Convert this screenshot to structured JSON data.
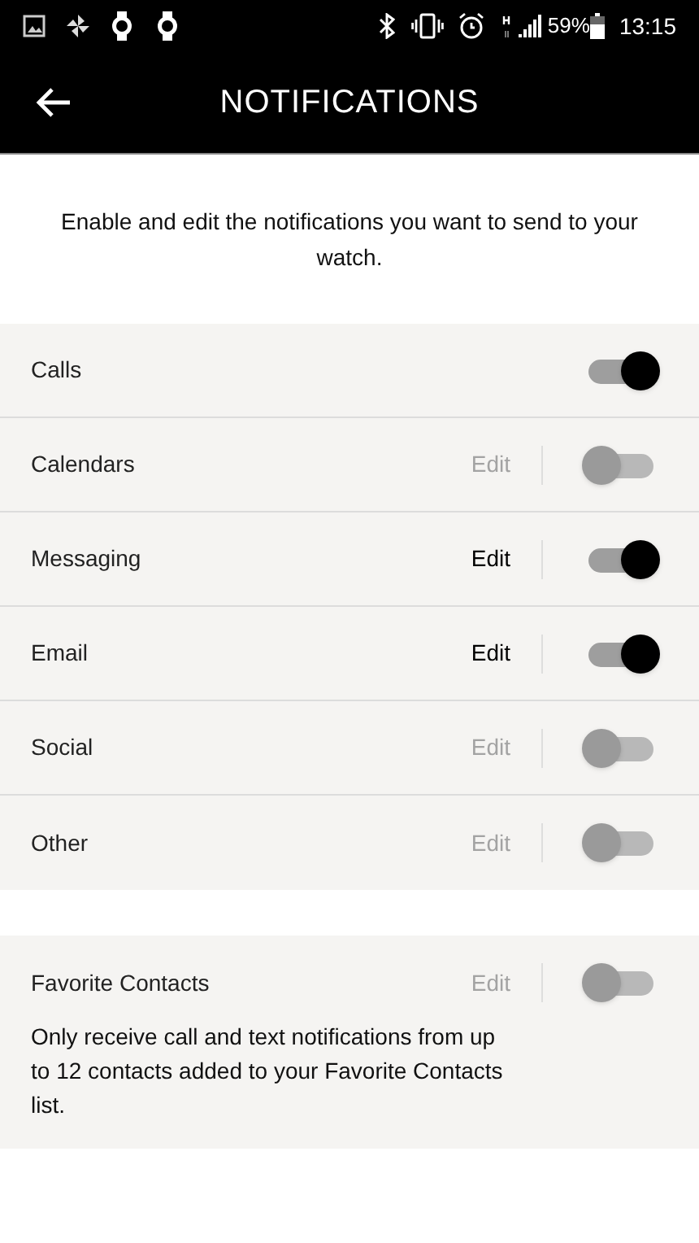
{
  "status_bar": {
    "battery": "59%",
    "time": "13:15"
  },
  "header": {
    "title": "NOTIFICATIONS"
  },
  "intro": "Enable and edit the notifications you want to send to your watch.",
  "items": [
    {
      "label": "Calls",
      "on": true
    },
    {
      "label": "Calendars",
      "on": false,
      "edit": {
        "label": "Edit",
        "disabled": true
      }
    },
    {
      "label": "Messaging",
      "on": true,
      "edit": {
        "label": "Edit",
        "disabled": false
      }
    },
    {
      "label": "Email",
      "on": true,
      "edit": {
        "label": "Edit",
        "disabled": false
      }
    },
    {
      "label": "Social",
      "on": false,
      "edit": {
        "label": "Edit",
        "disabled": true
      }
    },
    {
      "label": "Other",
      "on": false,
      "edit": {
        "label": "Edit",
        "disabled": true
      }
    }
  ],
  "favorites": {
    "label": "Favorite Contacts",
    "on": false,
    "edit": {
      "label": "Edit",
      "disabled": true
    },
    "description": "Only receive call and text notifications from up to 12 contacts added to your Favorite Contacts list."
  }
}
